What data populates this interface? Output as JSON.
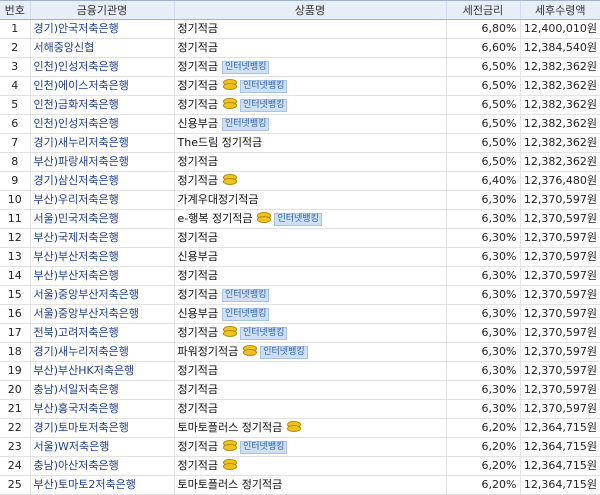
{
  "columns": [
    "번호",
    "금융기관명",
    "상품명",
    "세전금리",
    "세후수령액"
  ],
  "icons": {
    "coin": "coin-icon",
    "badge_color": "#cfe0f5"
  },
  "rows": [
    {
      "no": "1",
      "inst": "경기)안국저축은행",
      "product": "정기적금",
      "coin": false,
      "badge": "",
      "rate": "6,80%",
      "amount": "12,400,010원"
    },
    {
      "no": "2",
      "inst": "서해중앙신협",
      "product": "정기적금",
      "coin": false,
      "badge": "",
      "rate": "6,60%",
      "amount": "12,384,540원"
    },
    {
      "no": "3",
      "inst": "인천)인성저축은행",
      "product": "정기적금",
      "coin": false,
      "badge": "인터넷뱅킹",
      "rate": "6,50%",
      "amount": "12,382,362원"
    },
    {
      "no": "4",
      "inst": "인천)에이스저축은행",
      "product": "정기적금",
      "coin": true,
      "badge": "인터넷뱅킹",
      "rate": "6,50%",
      "amount": "12,382,362원"
    },
    {
      "no": "5",
      "inst": "인천)금화저축은행",
      "product": "정기적금",
      "coin": true,
      "badge": "인터넷뱅킹",
      "rate": "6,50%",
      "amount": "12,382,362원"
    },
    {
      "no": "6",
      "inst": "인천)인성저축은행",
      "product": "신용부금",
      "coin": false,
      "badge": "인터넷뱅킹",
      "rate": "6,50%",
      "amount": "12,382,362원"
    },
    {
      "no": "7",
      "inst": "경기)새누리저축은행",
      "product": "The드림 정기적금",
      "coin": false,
      "badge": "",
      "rate": "6,50%",
      "amount": "12,382,362원"
    },
    {
      "no": "8",
      "inst": "부산)파랑새저축은행",
      "product": "정기적금",
      "coin": false,
      "badge": "",
      "rate": "6,50%",
      "amount": "12,382,362원"
    },
    {
      "no": "9",
      "inst": "경기)삼신저축은행",
      "product": "정기적금",
      "coin": true,
      "badge": "",
      "rate": "6,40%",
      "amount": "12,376,480원"
    },
    {
      "no": "10",
      "inst": "부산)우리저축은행",
      "product": "가계우대정기적금",
      "coin": false,
      "badge": "",
      "rate": "6,30%",
      "amount": "12,370,597원"
    },
    {
      "no": "11",
      "inst": "서울)민국저축은행",
      "product": "e-행복 정기적금",
      "coin": true,
      "badge": "인터넷뱅킹",
      "rate": "6,30%",
      "amount": "12,370,597원"
    },
    {
      "no": "12",
      "inst": "부산)국제저축은행",
      "product": "정기적금",
      "coin": false,
      "badge": "",
      "rate": "6,30%",
      "amount": "12,370,597원"
    },
    {
      "no": "13",
      "inst": "부산)부산저축은행",
      "product": "신용부금",
      "coin": false,
      "badge": "",
      "rate": "6,30%",
      "amount": "12,370,597원"
    },
    {
      "no": "14",
      "inst": "부산)부산저축은행",
      "product": "정기적금",
      "coin": false,
      "badge": "",
      "rate": "6,30%",
      "amount": "12,370,597원"
    },
    {
      "no": "15",
      "inst": "서울)중앙부산저축은행",
      "product": "정기적금",
      "coin": false,
      "badge": "인터넷뱅킹",
      "rate": "6,30%",
      "amount": "12,370,597원"
    },
    {
      "no": "16",
      "inst": "서울)중앙부산저축은행",
      "product": "신용부금",
      "coin": false,
      "badge": "인터넷뱅킹",
      "rate": "6,30%",
      "amount": "12,370,597원"
    },
    {
      "no": "17",
      "inst": "전북)고려저축은행",
      "product": "정기적금",
      "coin": true,
      "badge": "인터넷뱅킹",
      "rate": "6,30%",
      "amount": "12,370,597원"
    },
    {
      "no": "18",
      "inst": "경기)새누리저축은행",
      "product": "파워정기적금",
      "coin": true,
      "badge": "인터넷뱅킹",
      "rate": "6,30%",
      "amount": "12,370,597원"
    },
    {
      "no": "19",
      "inst": "부산)부산HK저축은행",
      "product": "정기적금",
      "coin": false,
      "badge": "",
      "rate": "6,30%",
      "amount": "12,370,597원"
    },
    {
      "no": "20",
      "inst": "충남)서일저축은행",
      "product": "정기적금",
      "coin": false,
      "badge": "",
      "rate": "6,30%",
      "amount": "12,370,597원"
    },
    {
      "no": "21",
      "inst": "부산)홍국저축은행",
      "product": "정기적금",
      "coin": false,
      "badge": "",
      "rate": "6,30%",
      "amount": "12,370,597원"
    },
    {
      "no": "22",
      "inst": "경기)토마토저축은행",
      "product": "토마토플러스 정기적금",
      "coin": true,
      "badge": "",
      "rate": "6,20%",
      "amount": "12,364,715원"
    },
    {
      "no": "23",
      "inst": "서울)W저축은행",
      "product": "정기적금",
      "coin": true,
      "badge": "인터넷뱅킹",
      "rate": "6,20%",
      "amount": "12,364,715원"
    },
    {
      "no": "24",
      "inst": "충남)아산저축은행",
      "product": "정기적금",
      "coin": true,
      "badge": "",
      "rate": "6,20%",
      "amount": "12,364,715원"
    },
    {
      "no": "25",
      "inst": "부산)토마토2저축은행",
      "product": "토마토플러스 정기적금",
      "coin": false,
      "badge": "",
      "rate": "6,20%",
      "amount": "12,364,715원"
    }
  ]
}
